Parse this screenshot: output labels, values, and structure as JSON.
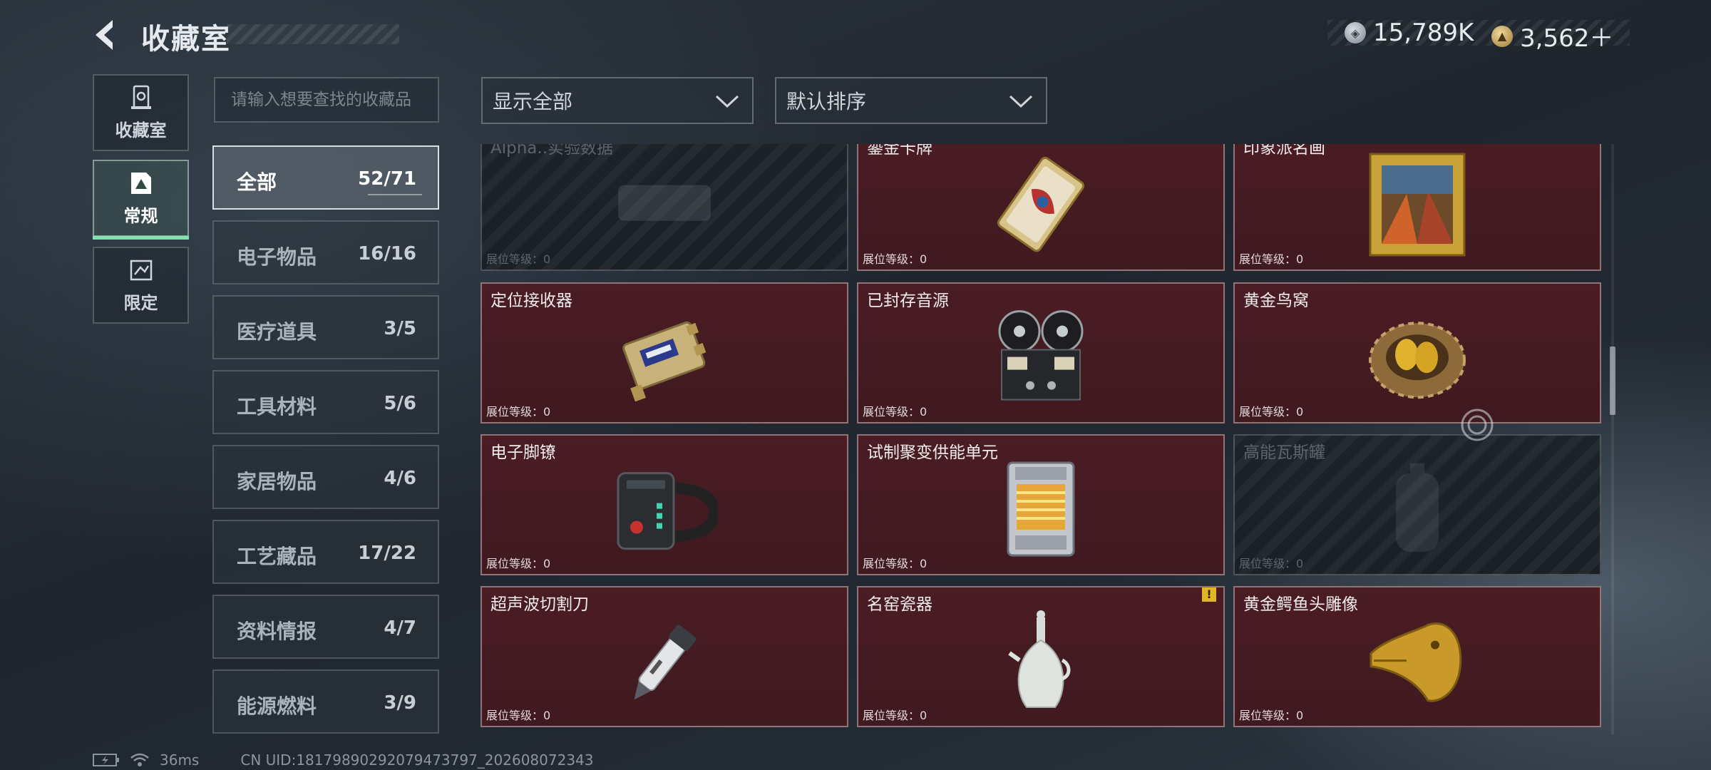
{
  "header": {
    "title": "收藏室",
    "currencies": [
      {
        "icon": "silver-coin-icon",
        "value": "15,789K"
      },
      {
        "icon": "gold-coin-icon",
        "value": "3,562＋"
      }
    ]
  },
  "nav_tabs": [
    {
      "label": "收藏室",
      "icon": "collection-room-icon",
      "active": false
    },
    {
      "label": "常规",
      "icon": "regular-icon",
      "active": true
    },
    {
      "label": "限定",
      "icon": "limited-icon",
      "active": false
    }
  ],
  "search": {
    "placeholder": "请输入想要查找的收藏品"
  },
  "filters": {
    "display": "显示全部",
    "sort": "默认排序"
  },
  "categories": [
    {
      "name": "全部",
      "count": "52/71",
      "active": true
    },
    {
      "name": "电子物品",
      "count": "16/16"
    },
    {
      "name": "医疗道具",
      "count": "3/5"
    },
    {
      "name": "工具材料",
      "count": "5/6"
    },
    {
      "name": "家居物品",
      "count": "4/6"
    },
    {
      "name": "工艺藏品",
      "count": "17/22"
    },
    {
      "name": "资料情报",
      "count": "4/7"
    },
    {
      "name": "能源燃料",
      "count": "3/9"
    }
  ],
  "level_label": "展位等级：0",
  "items": [
    {
      "name": "Alpha..实验数据",
      "locked": true,
      "icon": "drive-icon"
    },
    {
      "name": "鎏金卡牌",
      "locked": false,
      "icon": "gold-card-icon"
    },
    {
      "name": "印象派名画",
      "locked": false,
      "icon": "painting-icon"
    },
    {
      "name": "定位接收器",
      "locked": false,
      "icon": "receiver-icon"
    },
    {
      "name": "已封存音源",
      "locked": false,
      "icon": "reel-recorder-icon"
    },
    {
      "name": "黄金鸟窝",
      "locked": false,
      "icon": "golden-nest-icon"
    },
    {
      "name": "电子脚镣",
      "locked": false,
      "icon": "ankle-monitor-icon"
    },
    {
      "name": "试制聚变供能单元",
      "locked": false,
      "icon": "fusion-cell-icon"
    },
    {
      "name": "高能瓦斯罐",
      "locked": true,
      "icon": "gas-canister-icon"
    },
    {
      "name": "超声波切割刀",
      "locked": false,
      "icon": "ultrasonic-cutter-icon"
    },
    {
      "name": "名窑瓷器",
      "locked": false,
      "icon": "porcelain-vase-icon",
      "warning": "!"
    },
    {
      "name": "黄金鳄鱼头雕像",
      "locked": false,
      "icon": "golden-croc-head-icon"
    }
  ],
  "footer": {
    "ping": "36ms",
    "uid": "CN UID:18179890292079473797_202608072343"
  }
}
